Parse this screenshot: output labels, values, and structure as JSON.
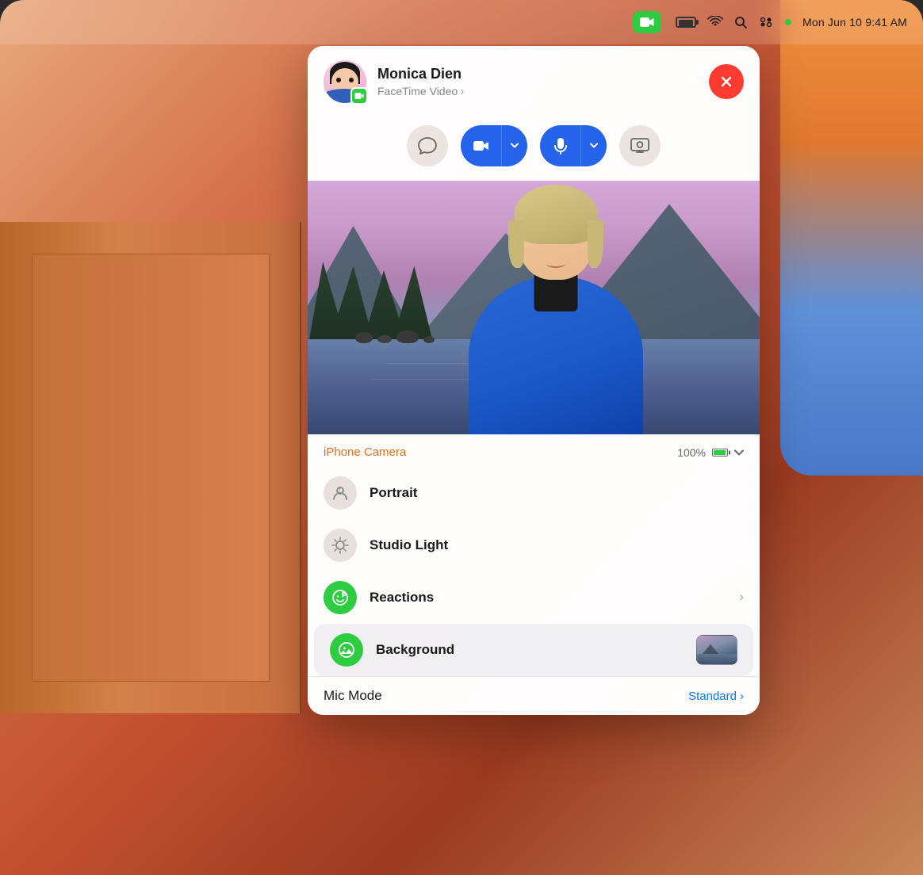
{
  "device": {
    "corner_radius": 30
  },
  "menubar": {
    "datetime": "Mon Jun 10  9:41 AM",
    "battery_pct": 100,
    "app_icon_label": "FaceTime"
  },
  "facetime": {
    "caller_name": "Monica Dien",
    "call_type": "FaceTime Video",
    "call_type_chevron": "›",
    "close_button_label": "×"
  },
  "controls": {
    "chat_icon": "message-icon",
    "video_icon": "video-camera-icon",
    "video_chevron": "chevron-down",
    "mic_icon": "microphone-icon",
    "mic_chevron": "chevron-down",
    "screen_icon": "screen-share-icon"
  },
  "iphone_camera": {
    "label": "iPhone Camera",
    "battery_pct": "100%",
    "chevron": "chevron-down"
  },
  "options": [
    {
      "id": "portrait",
      "label": "Portrait",
      "icon_type": "tan",
      "icon": "portrait-icon",
      "has_chevron": false,
      "has_thumbnail": false
    },
    {
      "id": "studio-light",
      "label": "Studio Light",
      "icon_type": "tan",
      "icon": "studio-light-icon",
      "has_chevron": false,
      "has_thumbnail": false
    },
    {
      "id": "reactions",
      "label": "Reactions",
      "icon_type": "green",
      "icon": "reactions-icon",
      "has_chevron": true,
      "has_thumbnail": false
    },
    {
      "id": "background",
      "label": "Background",
      "icon_type": "green",
      "icon": "background-icon",
      "has_chevron": false,
      "has_thumbnail": true,
      "selected": true
    }
  ],
  "mic_mode": {
    "label": "Mic Mode",
    "value": "Standard",
    "chevron": "›"
  }
}
